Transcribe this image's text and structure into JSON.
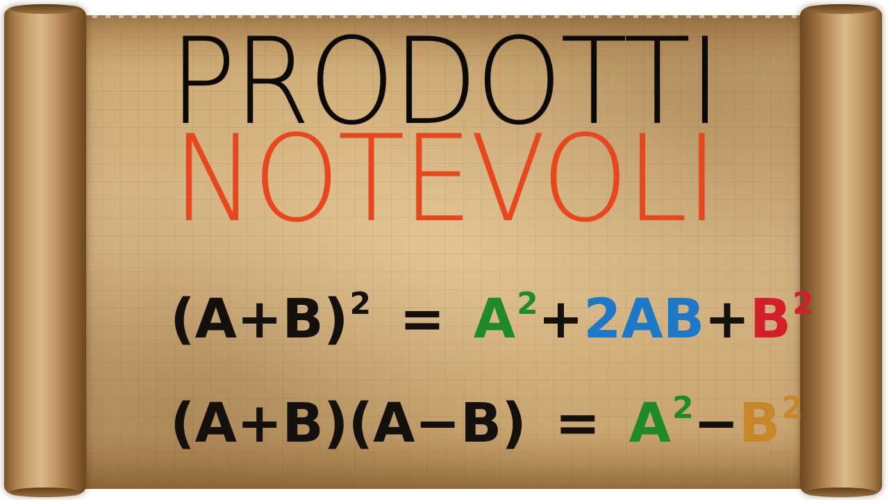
{
  "title": {
    "line1": "PRODOTTI",
    "line2": "NOTEVOLI"
  },
  "formulas": {
    "square_of_sum": {
      "lhs": "(A+B)",
      "lhs_exp": "2",
      "eq": "=",
      "t1": "A",
      "t1_exp": "2",
      "p1": "+",
      "t2": "2AB",
      "p2": "+",
      "t3": "B",
      "t3_exp": "2"
    },
    "difference_of_squares": {
      "lhs": "(A+B)(A−B)",
      "eq": "=",
      "t1": "A",
      "t1_exp": "2",
      "minus": "−",
      "t2": "B",
      "t2_exp": "2"
    }
  },
  "colors": {
    "background_accent": "#d8b888",
    "title_line1": "#0c0a07",
    "title_line2": "#e8461c",
    "formula_ink": "#14110d",
    "term_a_squared": "#1f8a2a",
    "term_2ab": "#1d78c8",
    "term_b_squared": "#d21f2a",
    "term_b_squared_2": "#c8862a"
  }
}
